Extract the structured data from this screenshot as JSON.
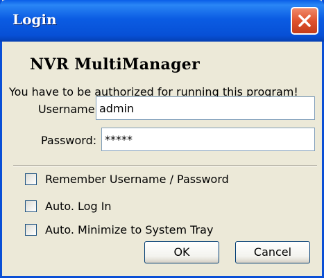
{
  "window": {
    "title": "Login"
  },
  "app": {
    "name": "NVR MultiManager",
    "message": "You have to be authorized for running this program!"
  },
  "form": {
    "username_label": "Username:",
    "username_value": "admin",
    "password_label": "Password:",
    "password_value": "*****"
  },
  "options": [
    {
      "label": "Remember Username / Password",
      "checked": false
    },
    {
      "label": "Auto. Log In",
      "checked": false
    },
    {
      "label": "Auto. Minimize to System Tray",
      "checked": false
    }
  ],
  "buttons": {
    "ok_label": "OK",
    "cancel_label": "Cancel"
  },
  "colors": {
    "titlebar": "#0b5ce3",
    "close_button": "#e0532e",
    "window_bg": "#ece9d8"
  },
  "icons": {
    "close": "close-icon"
  }
}
